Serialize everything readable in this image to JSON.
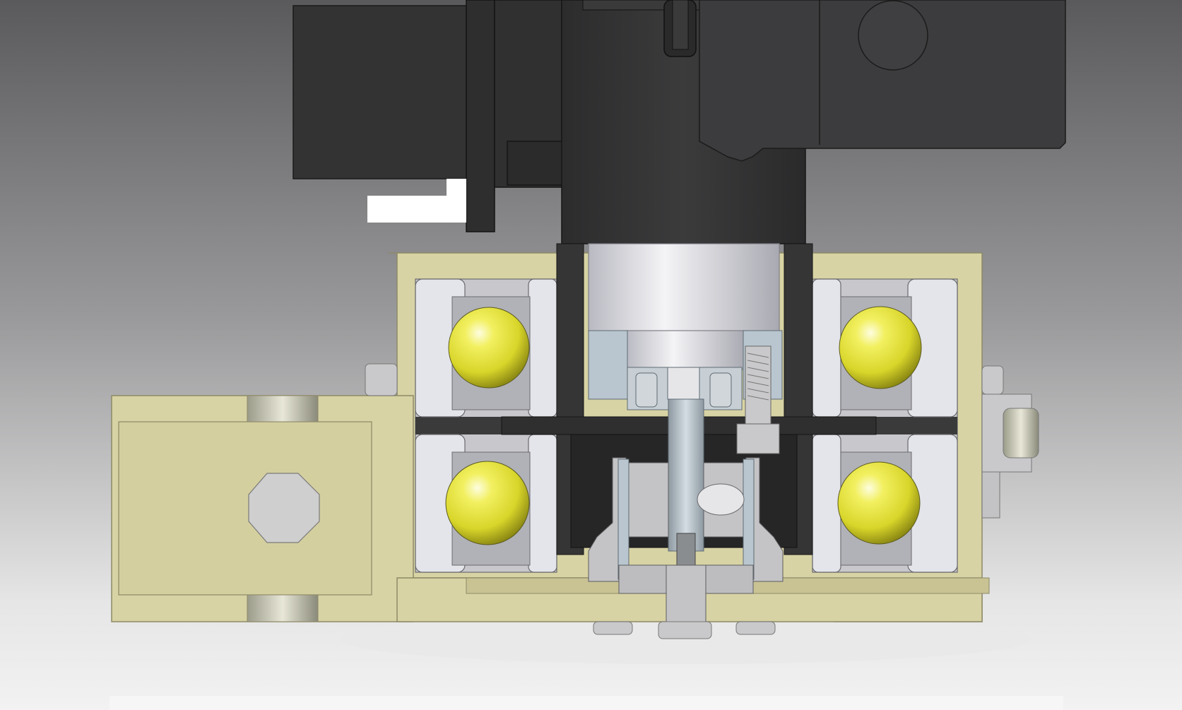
{
  "view": {
    "kind": "cad-section-view",
    "text_labels": [],
    "colors": {
      "background_top": "#5a5a5c",
      "background_bottom": "#f2f2f2",
      "housing_beige": "#d8d3a4",
      "housing_edge": "#8d8966",
      "motor_dark": "#353536",
      "bearing_race": "#e4e5ea",
      "ball_yellow": "#e6e43a",
      "shaft_steel": "#b9c6cf",
      "hub_grey": "#c4c4c6"
    }
  },
  "components": [
    {
      "id": "motor-block",
      "icon": "motor-housing-shape"
    },
    {
      "id": "upper-right-housing",
      "icon": "housing-block-shape"
    },
    {
      "id": "motor-rotor",
      "icon": "cylinder-shape"
    },
    {
      "id": "beige-housing",
      "icon": "u-channel-shape"
    },
    {
      "id": "mount-arm",
      "icon": "arm-with-bore-shape"
    },
    {
      "id": "bearing-top-left",
      "icon": "ball-bearing-shape"
    },
    {
      "id": "bearing-bottom-left",
      "icon": "ball-bearing-shape"
    },
    {
      "id": "bearing-top-right",
      "icon": "ball-bearing-shape"
    },
    {
      "id": "bearing-bottom-right",
      "icon": "ball-bearing-shape"
    },
    {
      "id": "center-shaft",
      "icon": "shaft-shape"
    },
    {
      "id": "hub",
      "icon": "hub-shape"
    },
    {
      "id": "screws",
      "icon": "screw-shape"
    }
  ]
}
